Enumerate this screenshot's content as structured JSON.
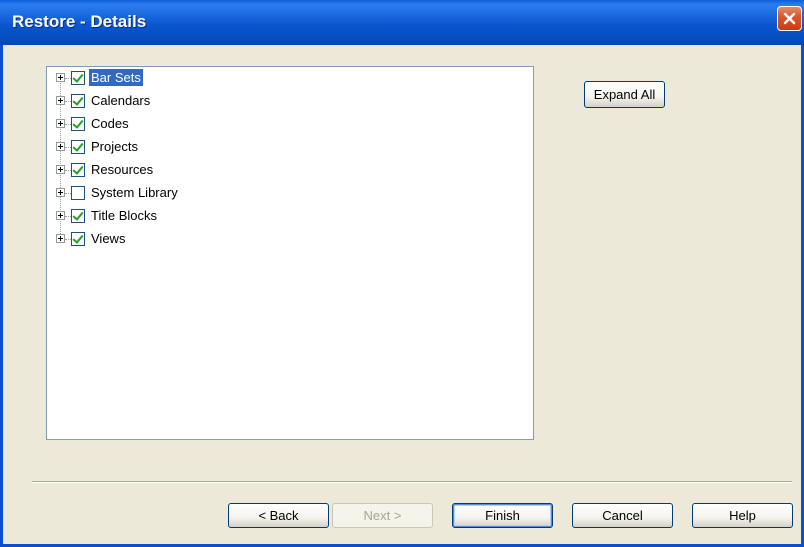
{
  "window": {
    "title": "Restore - Details",
    "close_icon": "close-icon"
  },
  "tree": {
    "items": [
      {
        "label": "Bar Sets",
        "checked": true,
        "selected": true
      },
      {
        "label": "Calendars",
        "checked": true,
        "selected": false
      },
      {
        "label": "Codes",
        "checked": true,
        "selected": false
      },
      {
        "label": "Projects",
        "checked": true,
        "selected": false
      },
      {
        "label": "Resources",
        "checked": true,
        "selected": false
      },
      {
        "label": "System Library",
        "checked": false,
        "selected": false
      },
      {
        "label": "Title Blocks",
        "checked": true,
        "selected": false
      },
      {
        "label": "Views",
        "checked": true,
        "selected": false
      }
    ]
  },
  "buttons": {
    "expand_all": "Expand All",
    "back": "< Back",
    "next": "Next >",
    "finish": "Finish",
    "cancel": "Cancel",
    "help": "Help"
  },
  "colors": {
    "titlebar": "#0a57d0",
    "selection": "#316ac5",
    "check": "#21a121",
    "dialog_bg": "#ece9d8"
  }
}
